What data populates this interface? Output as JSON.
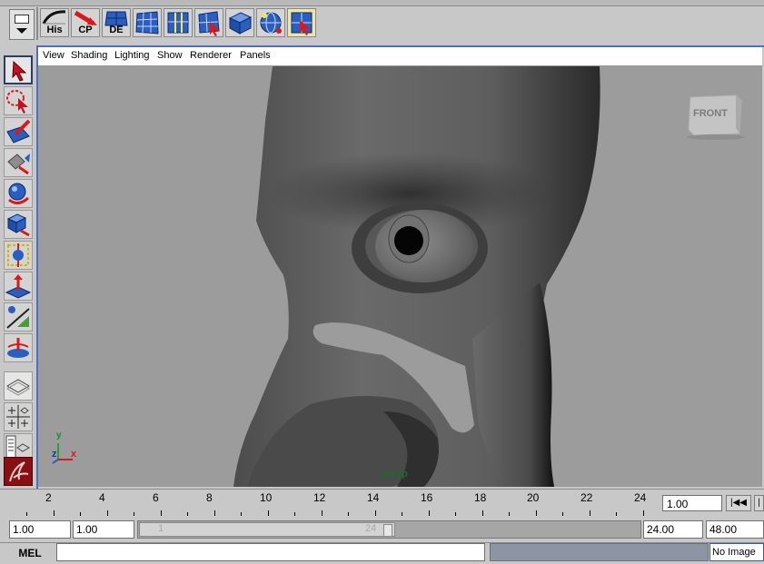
{
  "colors": {
    "panel_border": "#4f6fbf",
    "viewport_bg": "#9c9c9c",
    "current_frame_bg": "#161616",
    "command_result_bg": "#8a96a3"
  },
  "shelf": {
    "buttons": [
      {
        "label": "His",
        "icon": "history-icon"
      },
      {
        "label": "CP",
        "icon": "control-points-icon"
      },
      {
        "label": "DE",
        "icon": "delete-edges-icon"
      },
      {
        "label": "",
        "icon": "nurbs-grid-icon"
      },
      {
        "label": "",
        "icon": "insert-isoparm-icon"
      },
      {
        "label": "",
        "icon": "select-surface-icon"
      },
      {
        "label": "",
        "icon": "blue-cube-icon"
      },
      {
        "label": "",
        "icon": "globe-icon"
      },
      {
        "label": "",
        "icon": "select-grid-icon"
      }
    ]
  },
  "toolbox": {
    "tools": [
      {
        "name": "select-tool",
        "icon": "select-arrow-icon",
        "active": true
      },
      {
        "name": "lasso-tool",
        "icon": "lasso-icon"
      },
      {
        "name": "paint-select-tool",
        "icon": "paint-brush-icon"
      },
      {
        "name": "move-tool",
        "icon": "move-icon"
      },
      {
        "name": "rotate-tool",
        "icon": "rotate-icon"
      },
      {
        "name": "scale-tool",
        "icon": "scale-icon"
      },
      {
        "name": "universal-manipulator-tool",
        "icon": "universal-manip-icon"
      },
      {
        "name": "soft-modification-tool",
        "icon": "soft-mod-icon"
      },
      {
        "name": "show-manipulator-tool",
        "icon": "show-manip-icon"
      },
      {
        "name": "last-tool",
        "icon": "last-tool-icon"
      },
      {
        "name": "single-perspective-layout",
        "icon": "single-view-icon"
      },
      {
        "name": "four-view-layout",
        "icon": "four-view-icon"
      },
      {
        "name": "outliner-persp-layout",
        "icon": "outliner-layout-icon"
      },
      {
        "name": "maya-logo",
        "icon": "maya-logo-icon"
      }
    ]
  },
  "panel": {
    "menus": [
      "View",
      "Shading",
      "Lighting",
      "Show",
      "Renderer",
      "Panels"
    ],
    "view_cube_label": "FRONT",
    "camera_name": "persp",
    "axis": {
      "y": "y",
      "z": "z",
      "x": "x"
    }
  },
  "time_slider": {
    "current_frame": "1",
    "tick_labels": [
      "2",
      "4",
      "6",
      "8",
      "10",
      "12",
      "14",
      "16",
      "18",
      "20",
      "22",
      "24"
    ],
    "current_time_value": "1.00",
    "playback_buttons": [
      "go-to-start-icon",
      "step-back-icon"
    ]
  },
  "range_slider": {
    "anim_start": "1.00",
    "playback_start": "1.00",
    "range_inner_start": "1",
    "range_inner_end": "24",
    "playback_end": "24.00",
    "anim_end": "48.00"
  },
  "command_line": {
    "label": "MEL",
    "input_value": "",
    "help_line": "No Image"
  }
}
